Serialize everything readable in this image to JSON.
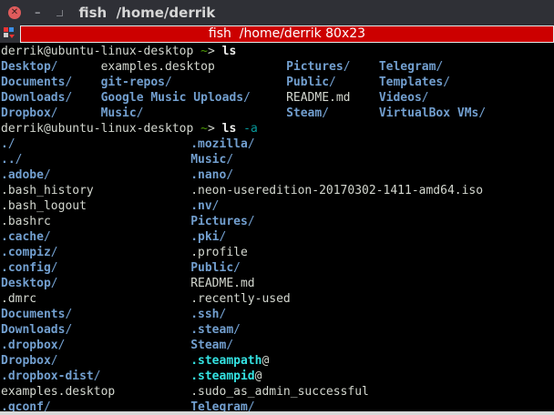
{
  "window": {
    "title": "fish  /home/derrik",
    "tab_title": "fish  /home/derrik 80x23"
  },
  "colors": {
    "dir": "#729fcf",
    "file": "#d3d7cf",
    "link": "#34e2e2",
    "tab": "#cc0000"
  },
  "prompts": [
    {
      "user": "derrik@ubuntu-linux-desktop ",
      "tilde": "~",
      "gt": "> ",
      "cmd": "ls",
      "arg": ""
    },
    {
      "user": "derrik@ubuntu-linux-desktop ",
      "tilde": "~",
      "gt": "> ",
      "cmd": "ls",
      "arg": " -a"
    }
  ],
  "ls_output": [
    [
      {
        "n": "Desktop",
        "s": "/",
        "t": "dir"
      },
      {
        "n": "examples.desktop",
        "s": "",
        "t": "file"
      },
      {
        "n": "Pictures",
        "s": "/",
        "t": "dir"
      },
      {
        "n": "Telegram",
        "s": "/",
        "t": "dir"
      }
    ],
    [
      {
        "n": "Documents",
        "s": "/",
        "t": "dir"
      },
      {
        "n": "git-repos",
        "s": "/",
        "t": "dir"
      },
      {
        "n": "Public",
        "s": "/",
        "t": "dir"
      },
      {
        "n": "Templates",
        "s": "/",
        "t": "dir"
      }
    ],
    [
      {
        "n": "Downloads",
        "s": "/",
        "t": "dir"
      },
      {
        "n": "Google Music Uploads",
        "s": "/",
        "t": "dir"
      },
      {
        "n": "README.md",
        "s": "",
        "t": "file"
      },
      {
        "n": "Videos",
        "s": "/",
        "t": "dir"
      }
    ],
    [
      {
        "n": "Dropbox",
        "s": "/",
        "t": "dir"
      },
      {
        "n": "Music",
        "s": "/",
        "t": "dir"
      },
      {
        "n": "Steam",
        "s": "/",
        "t": "dir"
      },
      {
        "n": "VirtualBox VMs",
        "s": "/",
        "t": "dir"
      }
    ]
  ],
  "ls_a_output": [
    [
      {
        "n": ".",
        "s": "/",
        "t": "dir"
      },
      {
        "n": ".mozilla",
        "s": "/",
        "t": "dir"
      }
    ],
    [
      {
        "n": "..",
        "s": "/",
        "t": "dir"
      },
      {
        "n": "Music",
        "s": "/",
        "t": "dir"
      }
    ],
    [
      {
        "n": ".adobe",
        "s": "/",
        "t": "dir"
      },
      {
        "n": ".nano",
        "s": "/",
        "t": "dir"
      }
    ],
    [
      {
        "n": ".bash_history",
        "s": "",
        "t": "file"
      },
      {
        "n": ".neon-useredition-20170302-1411-amd64.iso",
        "s": "",
        "t": "file"
      }
    ],
    [
      {
        "n": ".bash_logout",
        "s": "",
        "t": "file"
      },
      {
        "n": ".nv",
        "s": "/",
        "t": "dir"
      }
    ],
    [
      {
        "n": ".bashrc",
        "s": "",
        "t": "file"
      },
      {
        "n": "Pictures",
        "s": "/",
        "t": "dir"
      }
    ],
    [
      {
        "n": ".cache",
        "s": "/",
        "t": "dir"
      },
      {
        "n": ".pki",
        "s": "/",
        "t": "dir"
      }
    ],
    [
      {
        "n": ".compiz",
        "s": "/",
        "t": "dir"
      },
      {
        "n": ".profile",
        "s": "",
        "t": "file"
      }
    ],
    [
      {
        "n": ".config",
        "s": "/",
        "t": "dir"
      },
      {
        "n": "Public",
        "s": "/",
        "t": "dir"
      }
    ],
    [
      {
        "n": "Desktop",
        "s": "/",
        "t": "dir"
      },
      {
        "n": "README.md",
        "s": "",
        "t": "file"
      }
    ],
    [
      {
        "n": ".dmrc",
        "s": "",
        "t": "file"
      },
      {
        "n": ".recently-used",
        "s": "",
        "t": "file"
      }
    ],
    [
      {
        "n": "Documents",
        "s": "/",
        "t": "dir"
      },
      {
        "n": ".ssh",
        "s": "/",
        "t": "dir"
      }
    ],
    [
      {
        "n": "Downloads",
        "s": "/",
        "t": "dir"
      },
      {
        "n": ".steam",
        "s": "/",
        "t": "dir"
      }
    ],
    [
      {
        "n": ".dropbox",
        "s": "/",
        "t": "dir"
      },
      {
        "n": "Steam",
        "s": "/",
        "t": "dir"
      }
    ],
    [
      {
        "n": "Dropbox",
        "s": "/",
        "t": "dir"
      },
      {
        "n": ".steampath",
        "s": "@",
        "t": "link"
      }
    ],
    [
      {
        "n": ".dropbox-dist",
        "s": "/",
        "t": "dir"
      },
      {
        "n": ".steampid",
        "s": "@",
        "t": "link"
      }
    ],
    [
      {
        "n": "examples.desktop",
        "s": "",
        "t": "file"
      },
      {
        "n": ".sudo_as_admin_successful",
        "s": "",
        "t": "file"
      }
    ],
    [
      {
        "n": ".gconf",
        "s": "/",
        "t": "dir"
      },
      {
        "n": "Telegram",
        "s": "/",
        "t": "dir"
      }
    ]
  ]
}
